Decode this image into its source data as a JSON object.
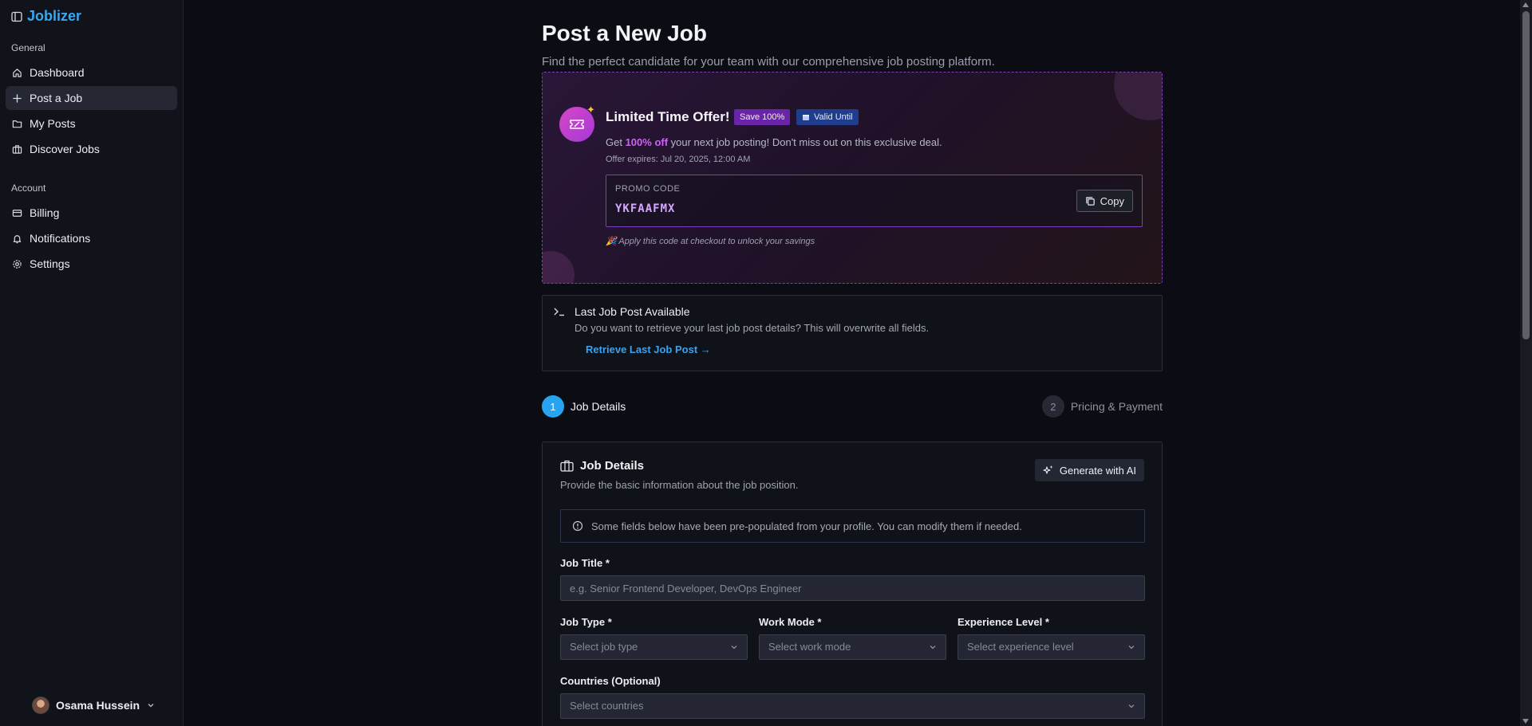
{
  "app": {
    "brand": "Joblizer"
  },
  "sidebar": {
    "general_heading": "General",
    "general_items": [
      {
        "label": "Dashboard",
        "icon": "home-icon"
      },
      {
        "label": "Post a Job",
        "icon": "plus-icon",
        "active": true
      },
      {
        "label": "My Posts",
        "icon": "folder-icon"
      },
      {
        "label": "Discover Jobs",
        "icon": "building-icon"
      }
    ],
    "account_heading": "Account",
    "account_items": [
      {
        "label": "Billing",
        "icon": "credit-card-icon"
      },
      {
        "label": "Notifications",
        "icon": "bell-icon"
      },
      {
        "label": "Settings",
        "icon": "gear-icon"
      }
    ],
    "user": {
      "name": "Osama Hussein"
    }
  },
  "page": {
    "title": "Post a New Job",
    "subtitle": "Find the perfect candidate for your team with our comprehensive job posting platform."
  },
  "offer": {
    "title": "Limited Time Offer!",
    "save_badge": "Save 100%",
    "valid_badge": "Valid Until",
    "desc_prefix": "Get ",
    "desc_highlight": "100% off",
    "desc_suffix": " your next job posting! Don't miss out on this exclusive deal.",
    "expires": "Offer expires: Jul 20, 2025, 12:00 AM",
    "promo_label": "PROMO CODE",
    "promo_code": "YKFAAFMX",
    "copy_label": "Copy",
    "hint": "🎉 Apply this code at checkout to unlock your savings",
    "colors": {
      "accent": "#c965f0",
      "border": "#7e3fb8"
    }
  },
  "last_post": {
    "title": "Last Job Post Available",
    "description": "Do you want to retrieve your last job post details? This will overwrite all fields.",
    "link": "Retrieve Last Job Post →"
  },
  "stepper": {
    "steps": [
      {
        "number": "1",
        "label": "Job Details",
        "active": true
      },
      {
        "number": "2",
        "label": "Pricing & Payment",
        "active": false
      }
    ]
  },
  "job_details": {
    "title": "Job Details",
    "subtitle": "Provide the basic information about the job position.",
    "generate_label": "Generate with AI",
    "notice": "Some fields below have been pre-populated from your profile. You can modify them if needed.",
    "job_title": {
      "label": "Job Title *",
      "placeholder": "e.g. Senior Frontend Developer, DevOps Engineer",
      "value": ""
    },
    "job_type": {
      "label": "Job Type *",
      "placeholder": "Select job type"
    },
    "work_mode": {
      "label": "Work Mode *",
      "placeholder": "Select work mode"
    },
    "experience": {
      "label": "Experience Level *",
      "placeholder": "Select experience level"
    },
    "countries": {
      "label": "Countries (Optional)",
      "placeholder": "Select countries"
    }
  },
  "colors": {
    "background": "#0c0d14",
    "sidebar": "#11131b",
    "brand": "#38a8f0",
    "link": "#3aa2ee",
    "step_active": "#27a3f0"
  }
}
